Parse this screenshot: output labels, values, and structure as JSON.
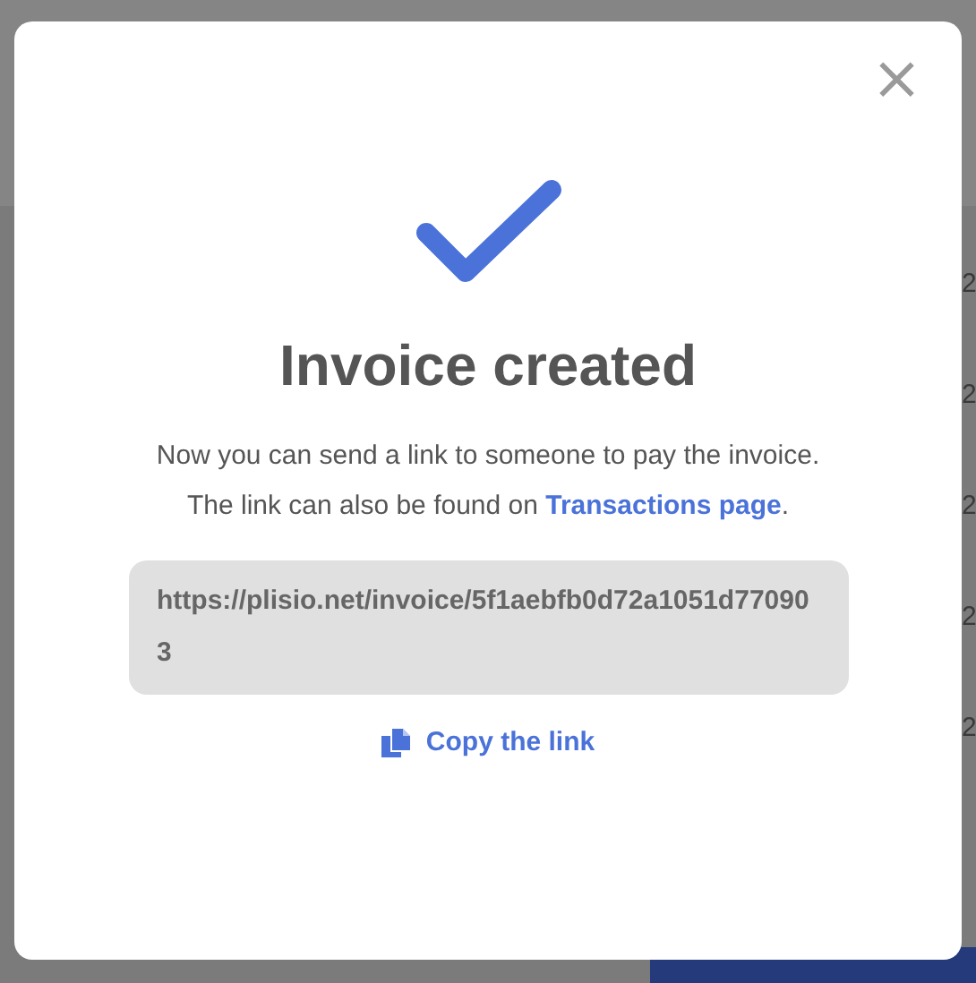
{
  "background": {
    "row_values": [
      "2",
      "2",
      "2",
      "2",
      "2"
    ]
  },
  "modal": {
    "close": "×",
    "title": "Invoice created",
    "message_before_link": "Now you can send a link to someone to pay the invoice. The link can also be found on",
    "message_link": "Transactions page",
    "message_after_link": ".",
    "invoice_url": "https://plisio.net/invoice/5f1aebfb0d72a1051d770903",
    "copy_label": "Copy the link"
  }
}
